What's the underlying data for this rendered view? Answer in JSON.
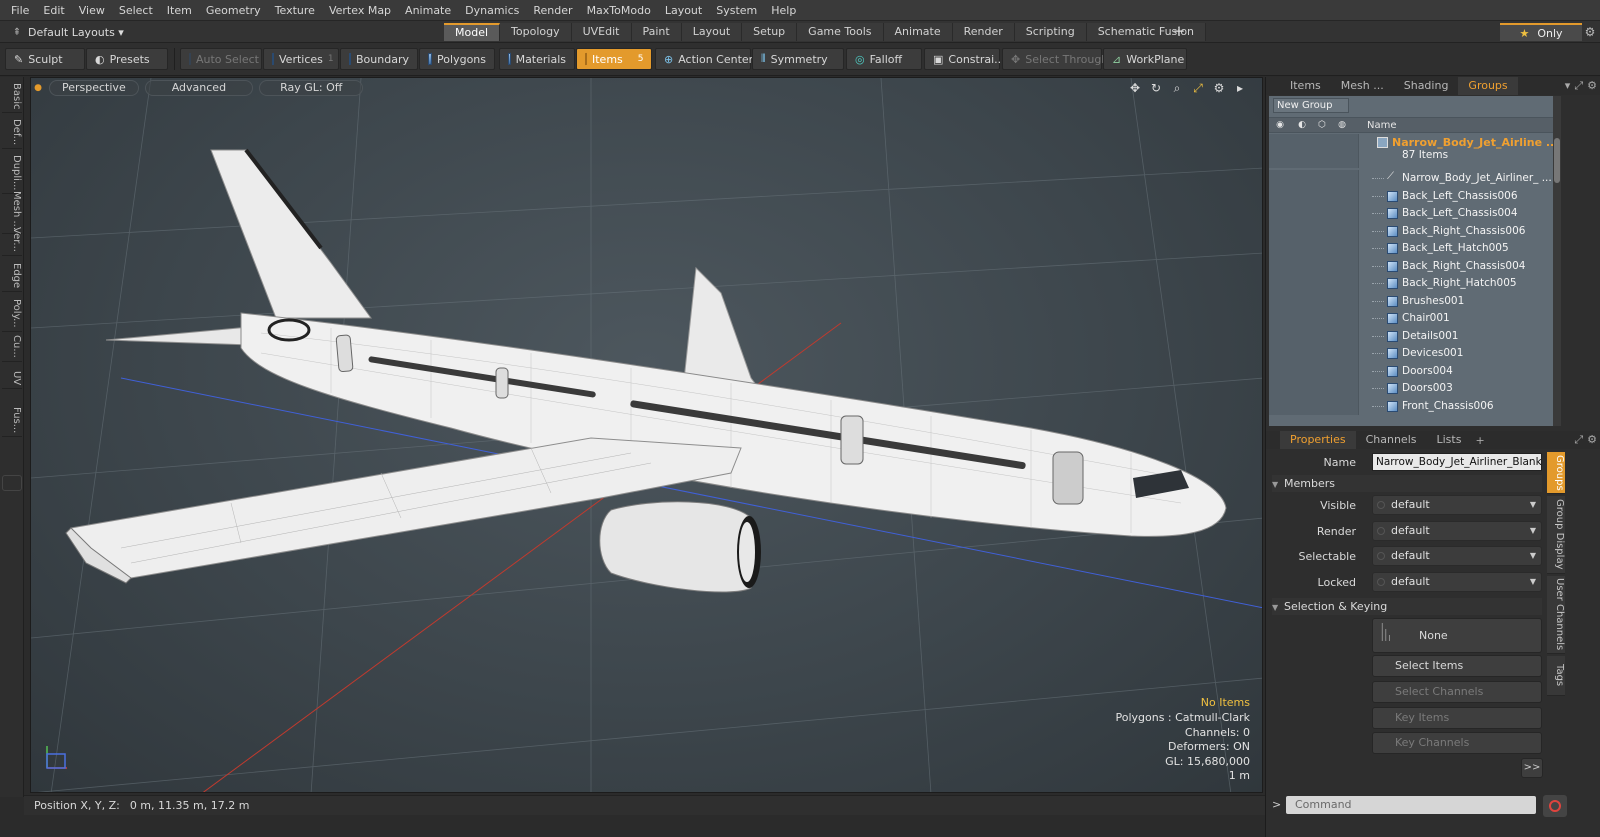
{
  "menu": [
    "File",
    "Edit",
    "View",
    "Select",
    "Item",
    "Geometry",
    "Texture",
    "Vertex Map",
    "Animate",
    "Dynamics",
    "Render",
    "MaxToModo",
    "Layout",
    "System",
    "Help"
  ],
  "layout": {
    "selector": "Default Layouts ▾",
    "only_label": "Only"
  },
  "tabs": [
    {
      "label": "Model",
      "active": true
    },
    {
      "label": "Topology"
    },
    {
      "label": "UVEdit"
    },
    {
      "label": "Paint"
    },
    {
      "label": "Layout"
    },
    {
      "label": "Setup"
    },
    {
      "label": "Game Tools"
    },
    {
      "label": "Animate"
    },
    {
      "label": "Render"
    },
    {
      "label": "Scripting"
    },
    {
      "label": "Schematic Fusion"
    }
  ],
  "toolbar": {
    "sculpt": "Sculpt",
    "presets": "Presets",
    "auto_select": "Auto Select",
    "vertices": "Vertices",
    "vertices_count": "1",
    "boundary": "Boundary",
    "polygons": "Polygons",
    "materials": "Materials",
    "items": "Items",
    "items_count": "5",
    "action_center": "Action Center",
    "symmetry": "Symmetry",
    "falloff": "Falloff",
    "constraints": "Constrai...",
    "select_through": "Select Through",
    "workplane": "WorkPlane"
  },
  "left_tabs": [
    "Basic",
    "Def...",
    "Dupli...",
    "Mesh ...",
    "Ver...",
    "Edge",
    "Poly...",
    "Cu...",
    "UV",
    "Fus..."
  ],
  "viewport": {
    "perspective": "Perspective",
    "advanced": "Advanced",
    "raygl": "Ray GL: Off",
    "info": {
      "no_items": "No Items",
      "polygons": "Polygons : Catmull-Clark",
      "channels": "Channels: 0",
      "deformers": "Deformers: ON",
      "gl": "GL: 15,680,000",
      "scale": "1 m"
    }
  },
  "status": {
    "label": "Position X, Y, Z:",
    "value": "0 m, 11.35 m, 17.2 m"
  },
  "groups_panel": {
    "tabs": [
      {
        "label": "Items"
      },
      {
        "label": "Mesh ..."
      },
      {
        "label": "Shading"
      },
      {
        "label": "Groups",
        "active": true
      }
    ],
    "new_group": "New Group",
    "name_header": "Name",
    "root": {
      "label": "Narrow_Body_Jet_Airline ...",
      "count": "87 Items"
    },
    "items": [
      "Narrow_Body_Jet_Airliner_ ...",
      "Back_Left_Chassis006",
      "Back_Left_Chassis004",
      "Back_Right_Chassis006",
      "Back_Left_Hatch005",
      "Back_Right_Chassis004",
      "Back_Right_Hatch005",
      "Brushes001",
      "Chair001",
      "Details001",
      "Devices001",
      "Doors004",
      "Doors003",
      "Front_Chassis006"
    ]
  },
  "props_panel": {
    "tabs": [
      {
        "label": "Properties",
        "active": true
      },
      {
        "label": "Channels"
      },
      {
        "label": "Lists"
      }
    ],
    "name_label": "Name",
    "name_value": "Narrow_Body_Jet_Airliner_Blank_",
    "members": "Members",
    "visible_label": "Visible",
    "visible": "default",
    "render_label": "Render",
    "render": "default",
    "selectable_label": "Selectable",
    "selectable": "default",
    "locked_label": "Locked",
    "locked": "default",
    "selection_keying": "Selection & Keying",
    "none": "None",
    "select_items": "Select Items",
    "select_channels": "Select Channels",
    "key_items": "Key Items",
    "key_channels": "Key Channels",
    "more": ">>",
    "side_tabs": [
      {
        "label": "Groups",
        "active": true
      },
      {
        "label": "Group Display"
      },
      {
        "label": "User Channels"
      },
      {
        "label": "Tags"
      }
    ]
  },
  "command": {
    "placeholder": "Command",
    "prompt": ">"
  }
}
